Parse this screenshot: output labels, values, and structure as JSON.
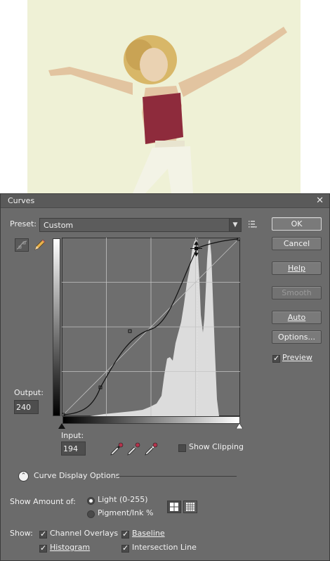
{
  "dialog": {
    "title": "Curves",
    "close_glyph": "✕"
  },
  "preset": {
    "label": "Preset:",
    "value": "Custom"
  },
  "buttons": {
    "ok": "OK",
    "cancel": "Cancel",
    "help": "Help",
    "smooth": "Smooth",
    "auto": "Auto",
    "options": "Options..."
  },
  "preview": {
    "label": "Preview",
    "checked": true
  },
  "output": {
    "label": "Output:",
    "value": "240"
  },
  "input": {
    "label": "Input:",
    "value": "194"
  },
  "show_clipping": {
    "label": "Show Clipping",
    "checked": false
  },
  "curve_display_options": {
    "label": "Curve Display Options"
  },
  "show_amount": {
    "label": "Show Amount of:",
    "options": [
      {
        "label": "Light  (0-255)",
        "selected": true
      },
      {
        "label": "Pigment/Ink %",
        "selected": false
      }
    ]
  },
  "show": {
    "label": "Show:",
    "channel_overlays": {
      "label": "Channel Overlays",
      "checked": true
    },
    "baseline": {
      "label": "Baseline",
      "checked": true
    },
    "histogram": {
      "label": "Histogram",
      "checked": true
    },
    "intersection_line": {
      "label": "Intersection Line",
      "checked": true
    }
  },
  "curve_points": [
    [
      0,
      0
    ],
    [
      55,
      40
    ],
    [
      128,
      125
    ],
    [
      194,
      240
    ],
    [
      255,
      255
    ]
  ],
  "icons": {
    "curve_tool": "curve-tool-icon",
    "pencil_tool": "pencil-icon",
    "preset_menu": "preset-options-menu-icon",
    "droppers": [
      "black-point-dropper-icon",
      "gray-point-dropper-icon",
      "white-point-dropper-icon"
    ],
    "grid_simple": "simple-grid-icon",
    "grid_detailed": "detailed-grid-icon"
  },
  "colors": {
    "dialog_bg": "#6b6b6b",
    "histogram": "#d8d8d8",
    "graph_bg": "#6e6e6e"
  }
}
